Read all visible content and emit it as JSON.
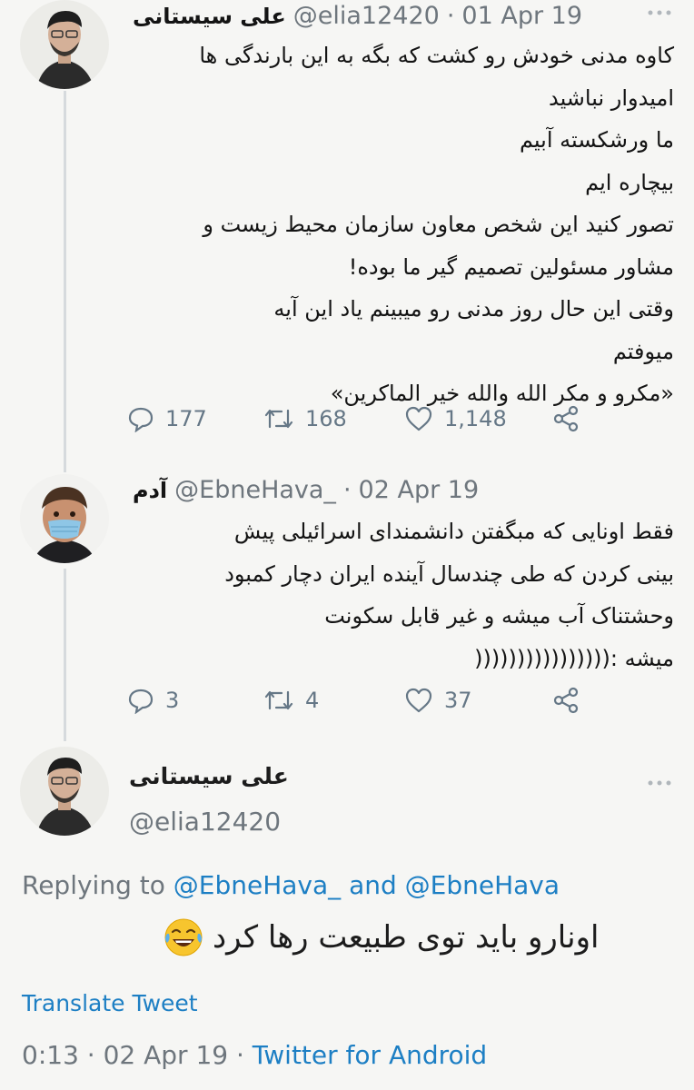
{
  "tweet1": {
    "name": "علی سیستانی",
    "handle": "@elia12420",
    "separator": " · ",
    "date": "01 Apr 19",
    "lines": [
      "کاوه مدنی خودش رو کشت که بگه به این بارندگی ها",
      "امیدوار نباشید",
      "ما ورشکسته آبیم",
      "بیچاره ایم",
      "تصور کنید این شخص معاون سازمان محیط زیست و",
      "مشاور مسئولین تصمیم گیر ما بوده!",
      "وقتی این حال روز مدنی رو میبینم یاد این آیه",
      "میوفتم",
      "«مکرو و مکر الله والله خیر الماکرین»"
    ],
    "replies": "177",
    "retweets": "168",
    "likes": "1,148"
  },
  "tweet2": {
    "name": "آدم",
    "handle": "@EbneHava_",
    "separator": " · ",
    "date": "02 Apr 19",
    "lines": [
      "فقط اونایی که مبگفتن دانشمندای اسرائیلی پیش",
      "بینی کردن که طی چندسال آینده ایران دچار کمبود",
      "وحشتناک آب میشه و غیر قابل سکونت",
      "میشه :(((((((((((((((("
    ],
    "replies": "3",
    "retweets": "4",
    "likes": "37"
  },
  "main_tweet": {
    "name": "علی سیستانی",
    "handle": "@elia12420",
    "replying_prefix": "Replying to",
    "replying_user1": "@EbneHava_",
    "replying_and": "and",
    "replying_user2": "@EbneHava",
    "text": "اونارو باید توی طبیعت رها کرد",
    "translate": "Translate Tweet",
    "time": "0:13",
    "separator": " · ",
    "date": "02 Apr 19",
    "app": "Twitter for Android"
  },
  "icons": {
    "reply": "reply-icon",
    "retweet": "retweet-icon",
    "like": "heart-icon",
    "share": "share-icon",
    "more": "more-icon",
    "emoji": "tears-of-joy-emoji"
  },
  "colors": {
    "link": "#1d7fc4",
    "muted": "#6e767d",
    "action": "#657786",
    "thread_line": "#d6dadd",
    "background": "#f6f6f4"
  }
}
